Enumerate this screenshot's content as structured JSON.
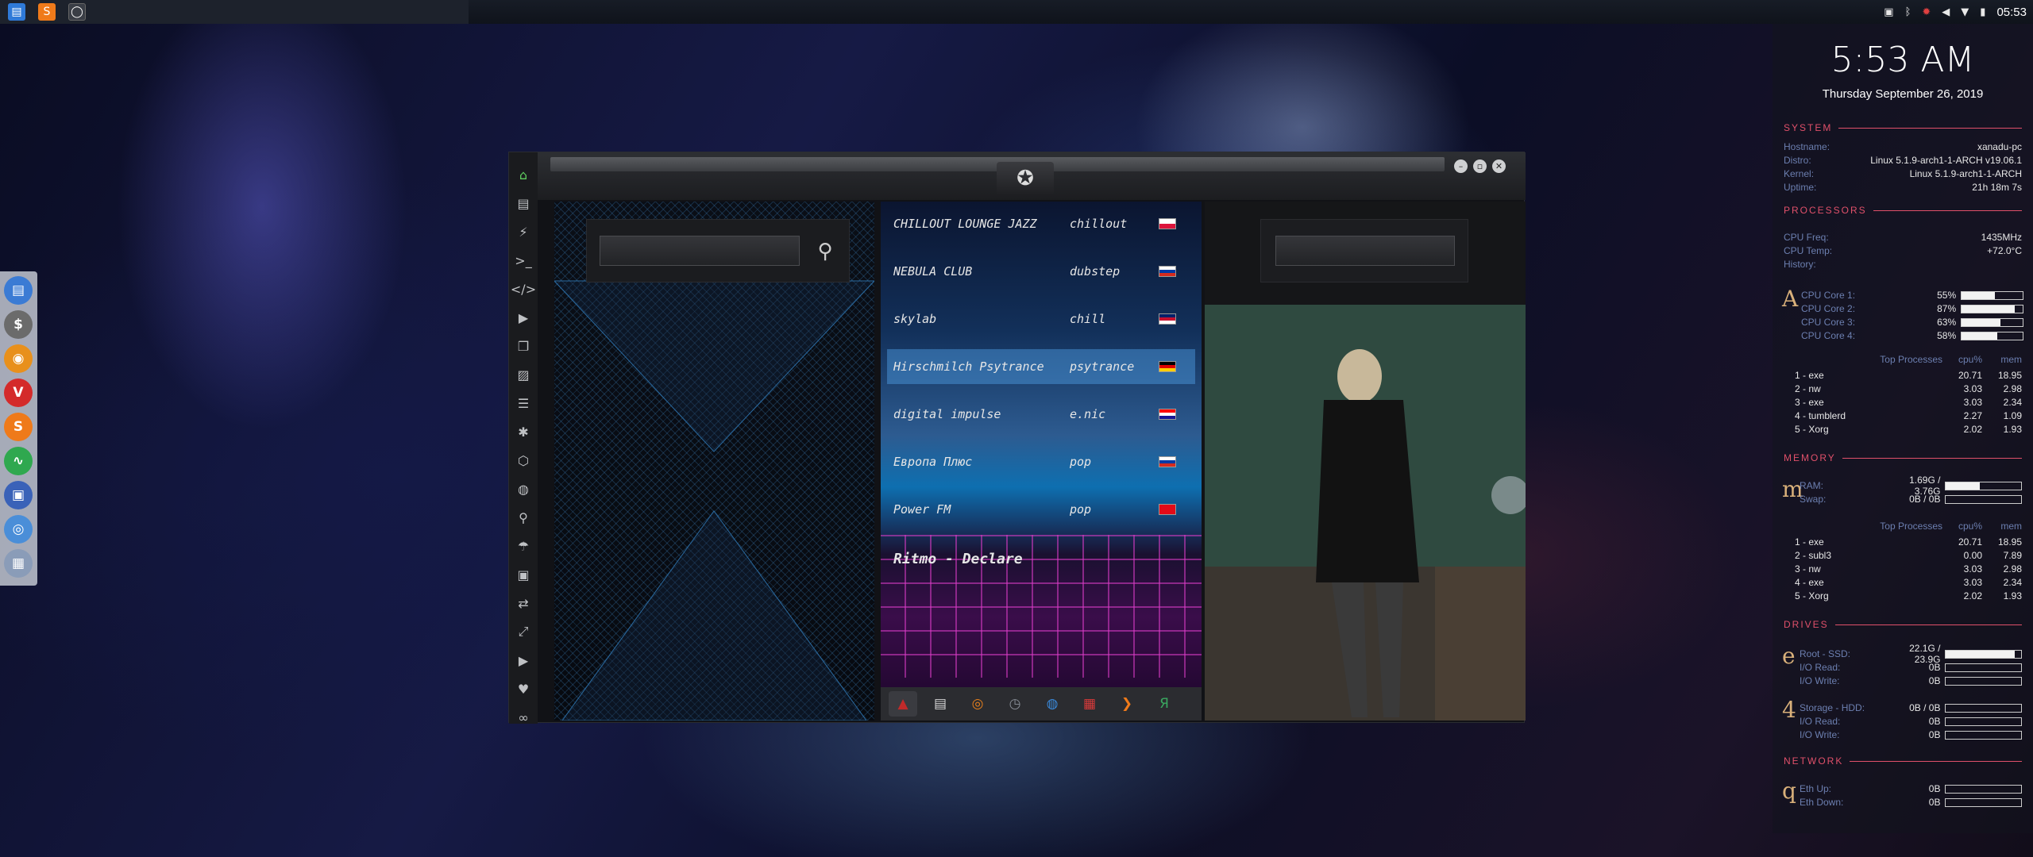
{
  "topbar": {
    "left_icons": [
      "files-icon",
      "sublime-icon",
      "circle-app-icon"
    ],
    "tray_icons": [
      "image-viewer-icon",
      "bluetooth-icon",
      "bug-icon",
      "volume-icon",
      "wifi-icon",
      "battery-icon"
    ],
    "clock": "05:53"
  },
  "dock": {
    "items": [
      {
        "name": "files",
        "color": "#3b7bd4",
        "glyph": "▤"
      },
      {
        "name": "money",
        "color": "#6b6b6b",
        "glyph": "$"
      },
      {
        "name": "ubuntu",
        "color": "#e8901c",
        "glyph": "◉"
      },
      {
        "name": "vivaldi",
        "color": "#d42a2a",
        "glyph": "V"
      },
      {
        "name": "sublime",
        "color": "#ef7a1a",
        "glyph": "S"
      },
      {
        "name": "activity",
        "color": "#2fa84f",
        "glyph": "∿"
      },
      {
        "name": "screen",
        "color": "#3a62b8",
        "glyph": "▣"
      },
      {
        "name": "chrome",
        "color": "#4a8ed8",
        "glyph": "◎"
      },
      {
        "name": "grid",
        "color": "#8a9cb8",
        "glyph": "▦"
      }
    ]
  },
  "window": {
    "emblem": "✪",
    "controls": [
      "–",
      "▫",
      "✕"
    ],
    "sidebar_icons": [
      {
        "name": "home",
        "glyph": "⌂",
        "color": "#5fcf5f"
      },
      {
        "name": "document",
        "glyph": "▤"
      },
      {
        "name": "lightning",
        "glyph": "⚡"
      },
      {
        "name": "terminal",
        "glyph": ">_"
      },
      {
        "name": "code",
        "glyph": "</>"
      },
      {
        "name": "play",
        "glyph": "▶"
      },
      {
        "name": "copy",
        "glyph": "❐"
      },
      {
        "name": "picture",
        "glyph": "▨"
      },
      {
        "name": "newspaper",
        "glyph": "☰"
      },
      {
        "name": "settings",
        "glyph": "✱"
      },
      {
        "name": "hexagon",
        "glyph": "⬡"
      },
      {
        "name": "globe",
        "glyph": "◍"
      },
      {
        "name": "search",
        "glyph": "⚲"
      },
      {
        "name": "umbrella",
        "glyph": "☂"
      },
      {
        "name": "contact",
        "glyph": "▣"
      },
      {
        "name": "link",
        "glyph": "⇄"
      },
      {
        "name": "fullscreen",
        "glyph": "⤢"
      },
      {
        "name": "youtube",
        "glyph": "▶"
      },
      {
        "name": "heart",
        "glyph": "♥"
      },
      {
        "name": "infinity",
        "glyph": "∞"
      }
    ],
    "search_left_placeholder": "",
    "search_right_placeholder": "",
    "stations": [
      {
        "name": "CHILLOUT LOUNGE JAZZ",
        "genre": "chillout",
        "flag": "pl"
      },
      {
        "name": "NEBULA CLUB",
        "genre": "dubstep",
        "flag": "ru"
      },
      {
        "name": "skylab",
        "genre": "chill",
        "flag": "gb"
      },
      {
        "name": "Hirschmilch Psytrance",
        "genre": "psytrance",
        "flag": "de"
      },
      {
        "name": "digital impulse",
        "genre": "e.nic",
        "flag": "hr"
      },
      {
        "name": "Европа Плюс",
        "genre": "pop",
        "flag": "ru"
      },
      {
        "name": "Power FM",
        "genre": "pop",
        "flag": "tr"
      }
    ],
    "now_playing": "Ritmo - Declare",
    "task_icons": [
      {
        "name": "arch",
        "color": "#c22a2a"
      },
      {
        "name": "calendar-page",
        "color": "#d8d8d8"
      },
      {
        "name": "magnifier",
        "color": "#e8801c"
      },
      {
        "name": "clock",
        "color": "#8a8f98"
      },
      {
        "name": "globe",
        "color": "#3a88d8"
      },
      {
        "name": "calendar",
        "color": "#d83a3a"
      },
      {
        "name": "arrow",
        "color": "#ef7a1a"
      },
      {
        "name": "yandex",
        "color": "#3aa860"
      }
    ]
  },
  "conky": {
    "time": "5:53 AM",
    "date": "Thursday September 26, 2019",
    "system": {
      "header": "SYSTEM",
      "rows": [
        {
          "k": "Hostname:",
          "v": "xanadu-pc"
        },
        {
          "k": "Distro:",
          "v": "Linux 5.1.9-arch1-1-ARCH v19.06.1"
        },
        {
          "k": "Kernel:",
          "v": "Linux 5.1.9-arch1-1-ARCH"
        },
        {
          "k": "Uptime:",
          "v": "21h 18m 7s"
        }
      ]
    },
    "processors": {
      "header": "PROCESSORS",
      "rows": [
        {
          "k": "CPU Freq:",
          "v": "1435MHz"
        },
        {
          "k": "CPU Temp:",
          "v": "+72.0°C"
        },
        {
          "k": "History:",
          "v": ""
        }
      ],
      "glyph": "A",
      "cores": [
        {
          "k": "CPU Core 1:",
          "p": "55%",
          "f": 0.55
        },
        {
          "k": "CPU Core 2:",
          "p": "87%",
          "f": 0.87
        },
        {
          "k": "CPU Core 3:",
          "p": "63%",
          "f": 0.63
        },
        {
          "k": "CPU Core 4:",
          "p": "58%",
          "f": 0.58
        }
      ],
      "top_header": [
        "Top Processes",
        "cpu%",
        "mem"
      ],
      "top": [
        {
          "n": "1 - exe",
          "c": "20.71",
          "m": "18.95"
        },
        {
          "n": "2 - nw",
          "c": "3.03",
          "m": "2.98"
        },
        {
          "n": "3 - exe",
          "c": "3.03",
          "m": "2.34"
        },
        {
          "n": "4 - tumblerd",
          "c": "2.27",
          "m": "1.09"
        },
        {
          "n": "5 - Xorg",
          "c": "2.02",
          "m": "1.93"
        }
      ]
    },
    "memory": {
      "header": "MEMORY",
      "glyph": "m",
      "rows": [
        {
          "k": "RAM:",
          "v": "1.69G / 3.76G",
          "f": 0.45
        },
        {
          "k": "Swap:",
          "v": "0B / 0B",
          "f": 0
        }
      ],
      "top_header": [
        "Top Processes",
        "cpu%",
        "mem"
      ],
      "top": [
        {
          "n": "1 - exe",
          "c": "20.71",
          "m": "18.95"
        },
        {
          "n": "2 - subl3",
          "c": "0.00",
          "m": "7.89"
        },
        {
          "n": "3 - nw",
          "c": "3.03",
          "m": "2.98"
        },
        {
          "n": "4 - exe",
          "c": "3.03",
          "m": "2.34"
        },
        {
          "n": "5 - Xorg",
          "c": "2.02",
          "m": "1.93"
        }
      ]
    },
    "drives": {
      "header": "DRIVES",
      "root": {
        "glyph": "e",
        "rows": [
          {
            "k": "Root - SSD:",
            "v": "22.1G / 23.9G",
            "f": 0.92
          },
          {
            "k": "I/O Read:",
            "v": "0B",
            "f": 0
          },
          {
            "k": "I/O Write:",
            "v": "0B",
            "f": 0
          }
        ]
      },
      "storage": {
        "glyph": "4",
        "rows": [
          {
            "k": "Storage - HDD:",
            "v": "0B / 0B",
            "f": 0
          },
          {
            "k": "I/O Read:",
            "v": "0B",
            "f": 0
          },
          {
            "k": "I/O Write:",
            "v": "0B",
            "f": 0
          }
        ]
      }
    },
    "network": {
      "header": "NETWORK",
      "glyph": "q",
      "rows": [
        {
          "k": "Eth Up:",
          "v": "0B",
          "f": 0
        },
        {
          "k": "Eth Down:",
          "v": "0B",
          "f": 0
        }
      ]
    }
  }
}
